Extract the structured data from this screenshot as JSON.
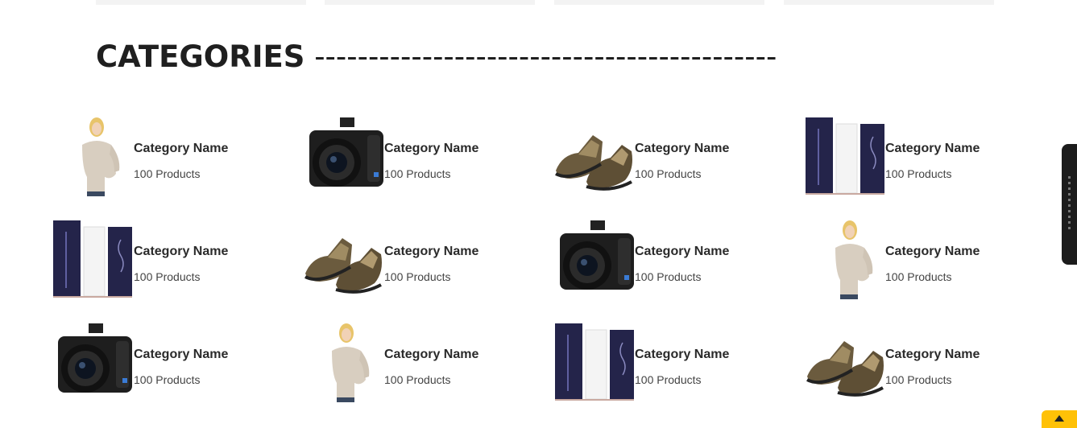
{
  "section": {
    "title": "CATEGORIES",
    "dashes": "-------------------------------------------"
  },
  "categories": [
    {
      "name": "Category Name",
      "count": "100 Products",
      "image": "woman-sweater"
    },
    {
      "name": "Category Name",
      "count": "100 Products",
      "image": "camera"
    },
    {
      "name": "Category Name",
      "count": "100 Products",
      "image": "shoes"
    },
    {
      "name": "Category Name",
      "count": "100 Products",
      "image": "cosmetic-tubes"
    },
    {
      "name": "Category Name",
      "count": "100 Products",
      "image": "cosmetic-tubes"
    },
    {
      "name": "Category Name",
      "count": "100 Products",
      "image": "shoes"
    },
    {
      "name": "Category Name",
      "count": "100 Products",
      "image": "camera"
    },
    {
      "name": "Category Name",
      "count": "100 Products",
      "image": "woman-sweater"
    },
    {
      "name": "Category Name",
      "count": "100 Products",
      "image": "camera"
    },
    {
      "name": "Category Name",
      "count": "100 Products",
      "image": "woman-sweater"
    },
    {
      "name": "Category Name",
      "count": "100 Products",
      "image": "cosmetic-tubes"
    },
    {
      "name": "Category Name",
      "count": "100 Products",
      "image": "shoes"
    }
  ],
  "icons": {
    "side_tab": "side-panel-tab",
    "scroll_top": "chevron-up-icon"
  },
  "colors": {
    "scroll_top_bg": "#ffc107",
    "side_tab_bg": "#1c1c1c"
  }
}
